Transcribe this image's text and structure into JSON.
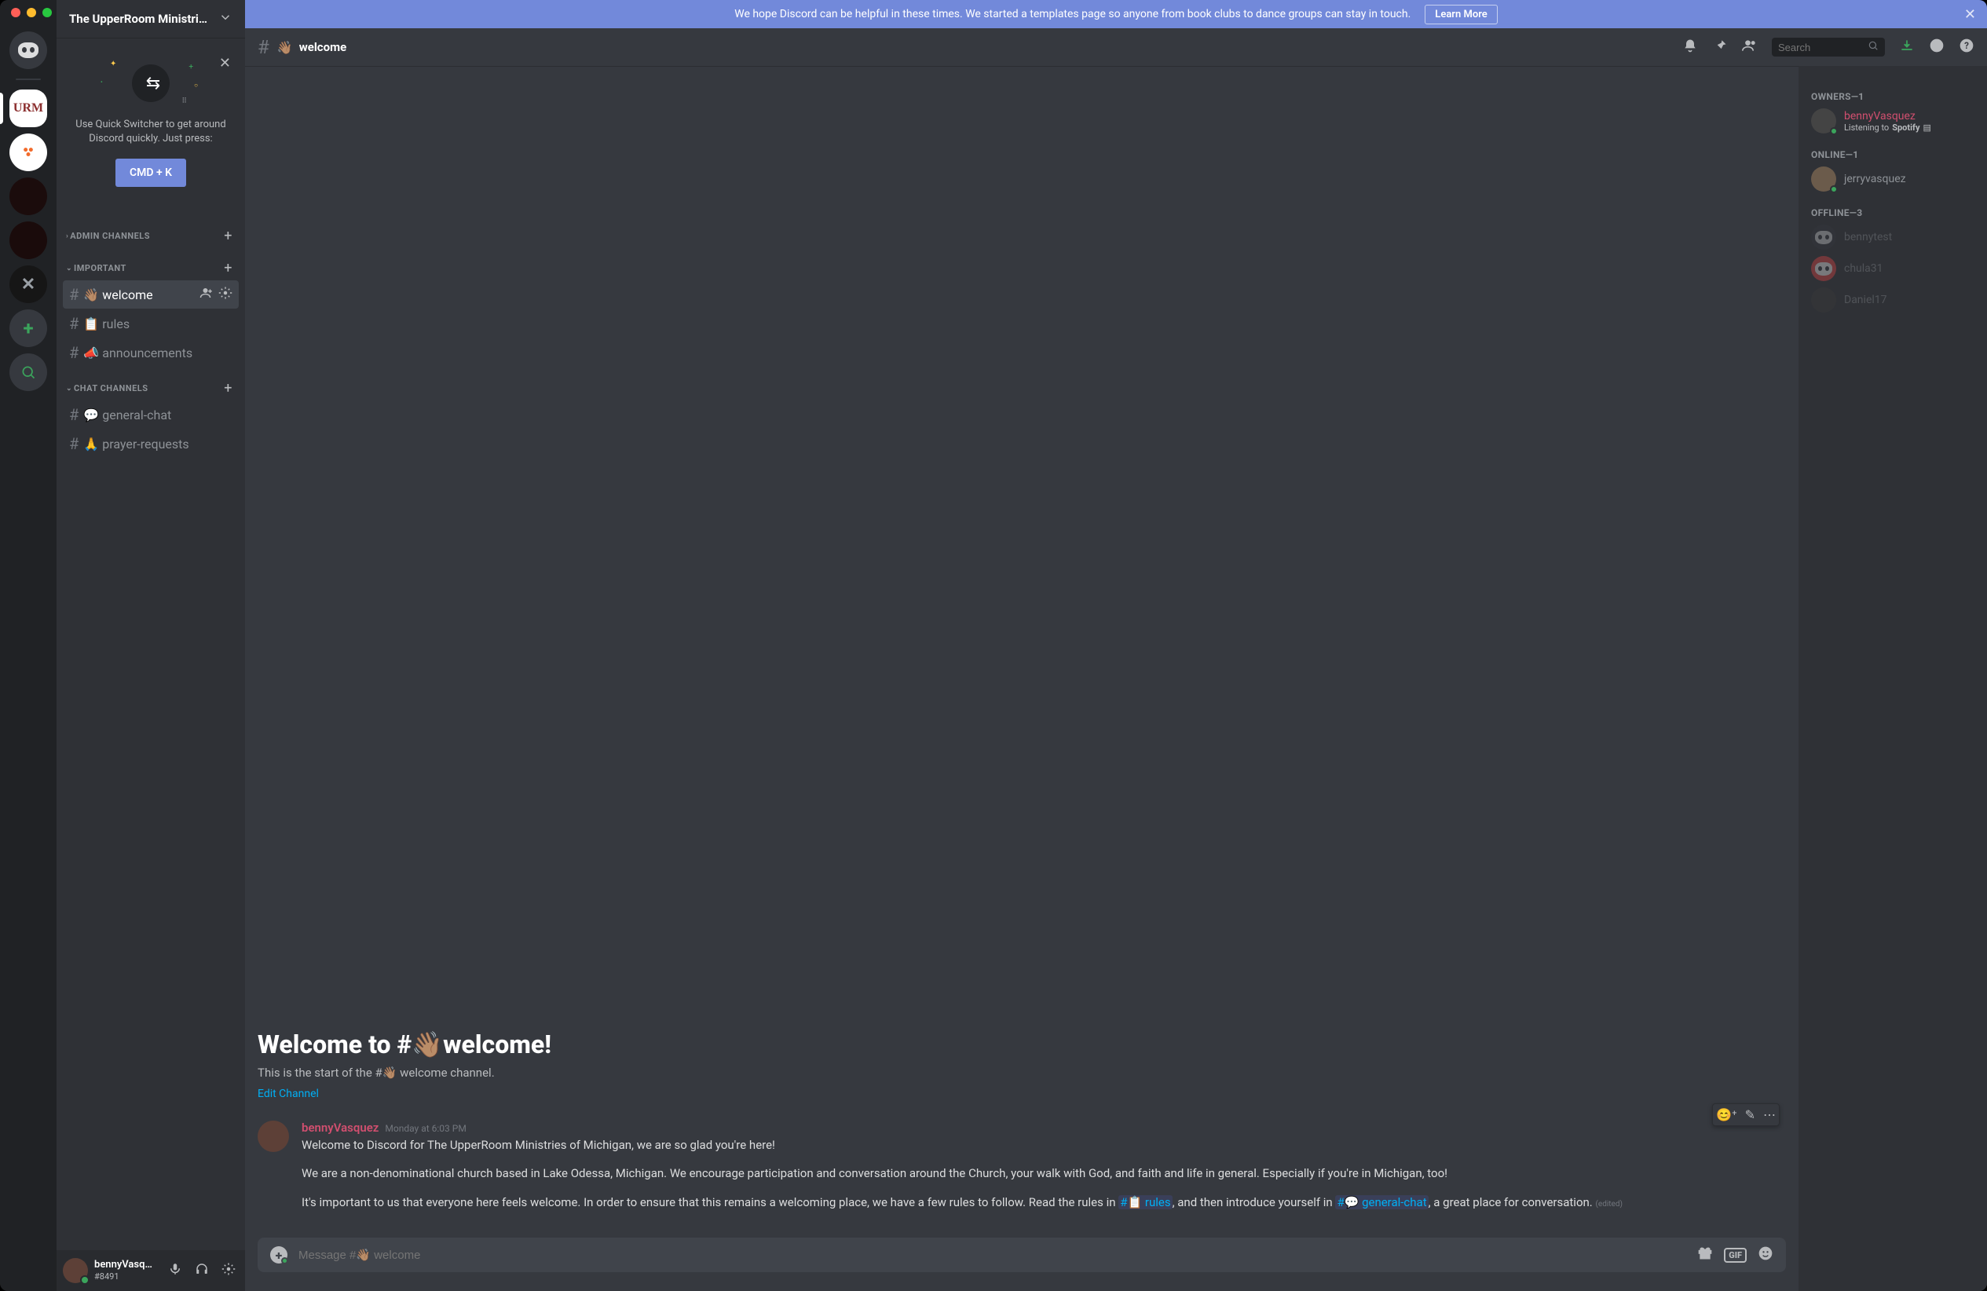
{
  "banner": {
    "text": "We hope Discord can be helpful in these times. We started a templates page so anyone from book clubs to dance groups can stay in touch.",
    "cta": "Learn More"
  },
  "server": {
    "name": "The UpperRoom Ministri…"
  },
  "quickSwitcher": {
    "line": "Use Quick Switcher to get around Discord quickly. Just press:",
    "button": "CMD + K"
  },
  "categories": {
    "admin": "Admin Channels",
    "important": "Important",
    "chat": "Chat Channels"
  },
  "channels": {
    "welcome": {
      "emoji": "👋🏽",
      "name": "welcome"
    },
    "rules": {
      "emoji": "📋",
      "name": "rules"
    },
    "announcements": {
      "emoji": "📣",
      "name": "announcements"
    },
    "general": {
      "emoji": "💬",
      "name": "general-chat"
    },
    "prayer": {
      "emoji": "🙏",
      "name": "prayer-requests"
    }
  },
  "header": {
    "channelEmoji": "👋🏽",
    "channelName": "welcome",
    "searchPlaceholder": "Search"
  },
  "welcomeBlock": {
    "titlePrefix": "Welcome to #",
    "titleEmoji": "👋🏽",
    "titleSuffix": "welcome!",
    "subPrefix": "This is the start of the #",
    "subEmoji": "👋🏽",
    "subSuffix": " welcome channel.",
    "editLink": "Edit Channel"
  },
  "message": {
    "author": "bennyVasquez",
    "timestamp": "Monday at 6:03 PM",
    "p1": "Welcome to Discord for The UpperRoom Ministries of Michigan, we are so glad you're here!",
    "p2": "We are a non-denominational church based in Lake Odessa, Michigan. We encourage participation and conversation around the Church, your walk with God, and faith and life in general. Especially if you're in Michigan, too!",
    "p3a": "It's important to us that everyone here feels welcome. In order to ensure that this remains a welcoming place, we have a few rules to follow. Read the rules in ",
    "p3link1": "#📋 rules",
    "p3b": ", and then introduce yourself in ",
    "p3link2": "#💬 general-chat",
    "p3c": ", a great place for conversation.",
    "edited": "(edited)"
  },
  "composer": {
    "placeholder": "Message #👋🏽 welcome",
    "gif": "GIF"
  },
  "userPanel": {
    "name": "bennyVasq…",
    "tag": "#8491"
  },
  "memberList": {
    "ownersHeader": "Owners—1",
    "onlineHeader": "Online—1",
    "offlineHeader": "Offline—3",
    "owner": {
      "name": "bennyVasquez",
      "activityPrefix": "Listening to ",
      "activityBold": "Spotify"
    },
    "online": [
      {
        "name": "jerryvasquez"
      }
    ],
    "offline": [
      {
        "name": "bennytest"
      },
      {
        "name": "chula31"
      },
      {
        "name": "Daniel17"
      }
    ]
  },
  "rail": {
    "urm": "URM",
    "x": "✕"
  }
}
